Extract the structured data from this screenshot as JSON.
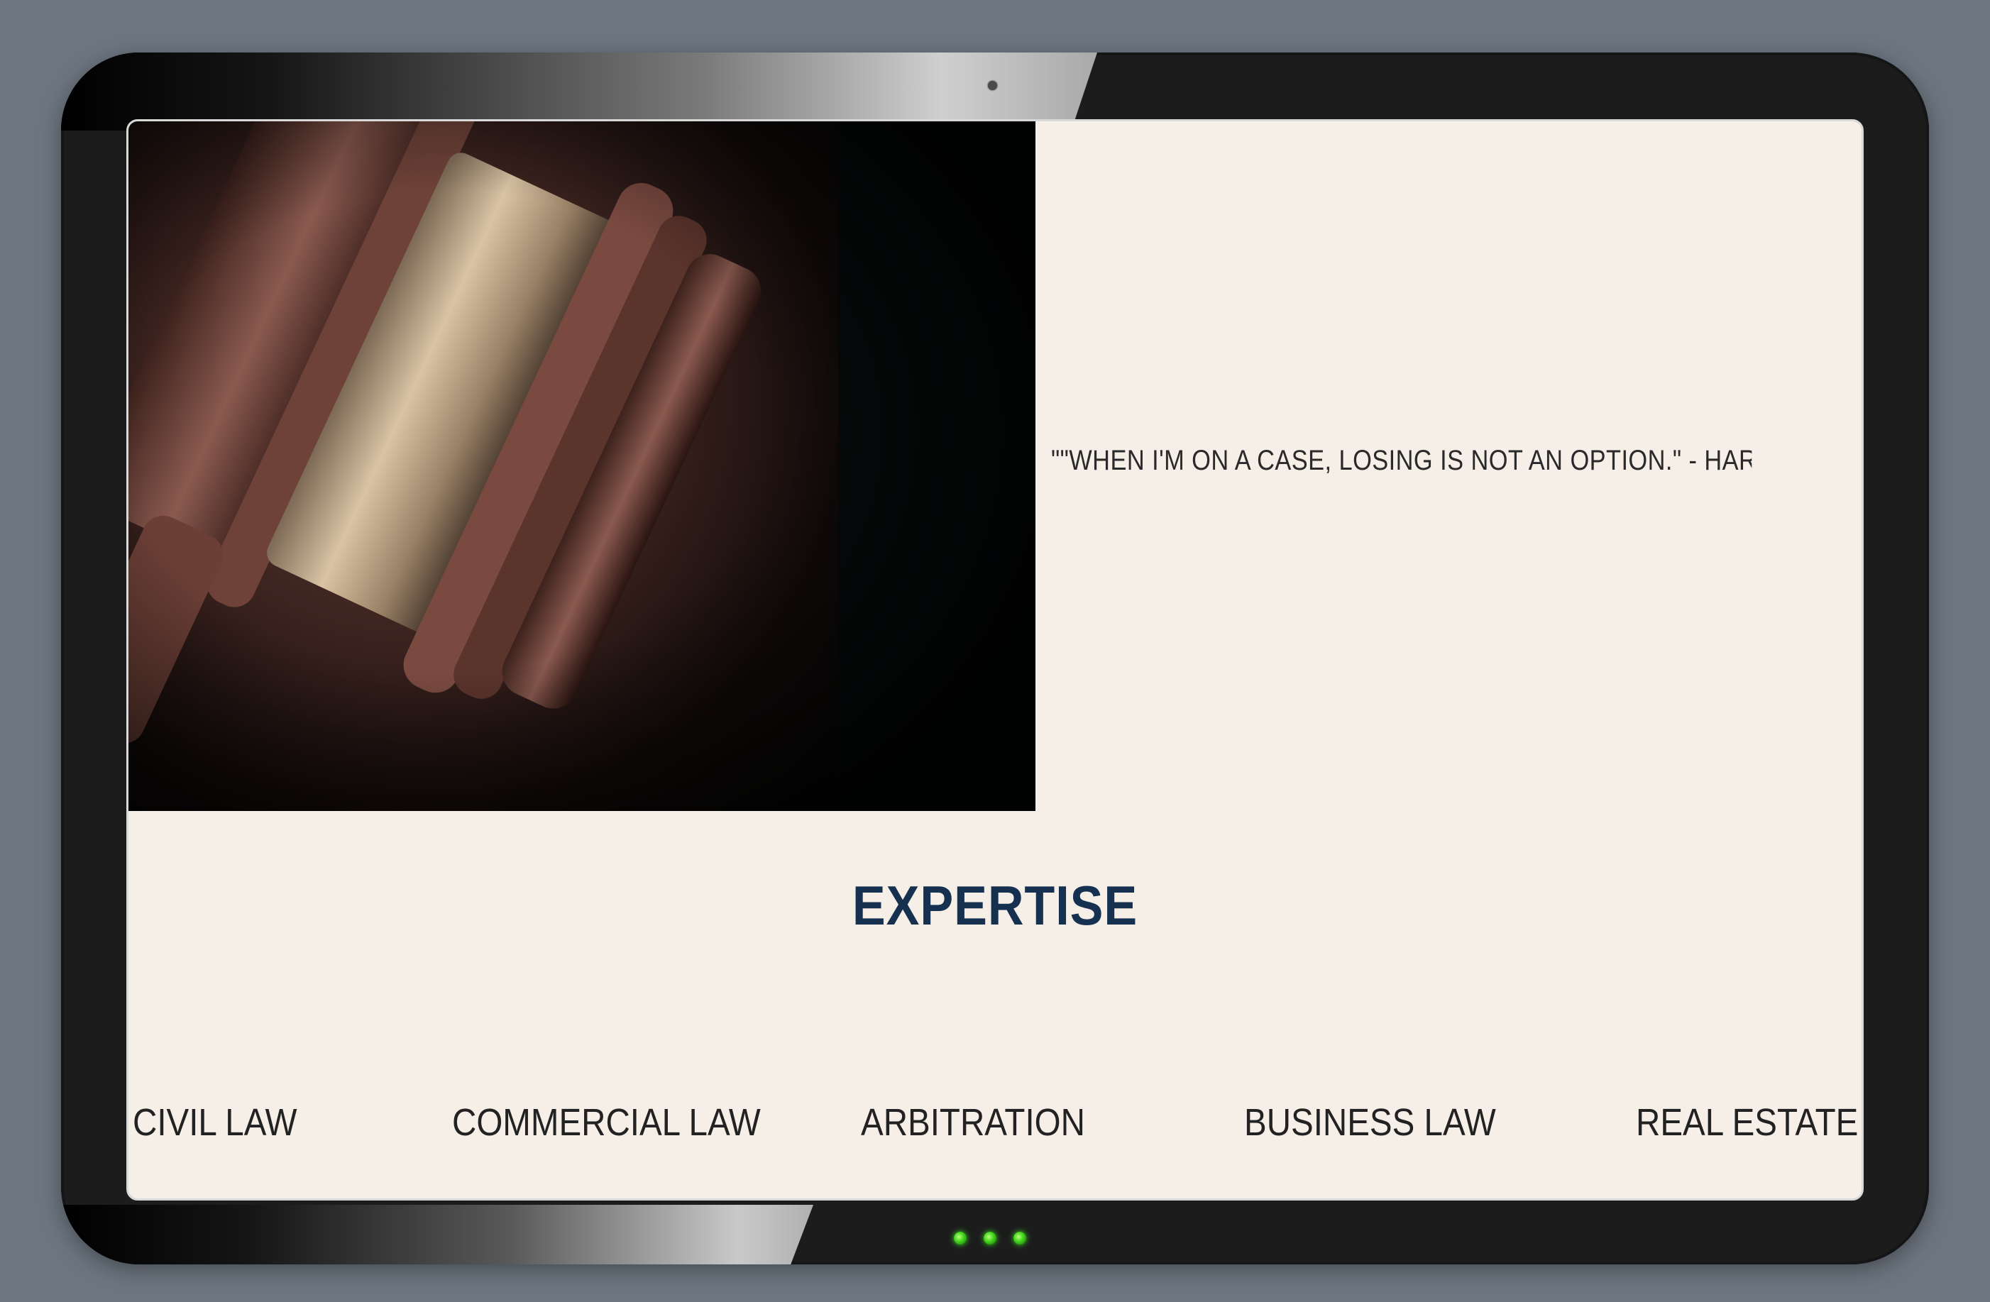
{
  "hero": {
    "image_alt": "gavel-photo",
    "quote": "\"\"WHEN I'M ON A CASE, LOSING IS NOT AN OPTION.\" - HARVEY SPECTI"
  },
  "expertise": {
    "title": "EXPERTISE",
    "items": [
      {
        "label": "CIVIL LAW"
      },
      {
        "label": "COMMERCIAL LAW"
      },
      {
        "label": "ARBITRATION"
      },
      {
        "label": "BUSINESS LAW"
      },
      {
        "label": "REAL ESTATE"
      }
    ]
  },
  "colors": {
    "page_background": "#6c7580",
    "screen_background": "#f5efe8",
    "title_color": "#16304f",
    "led_color": "#3fd21a"
  }
}
